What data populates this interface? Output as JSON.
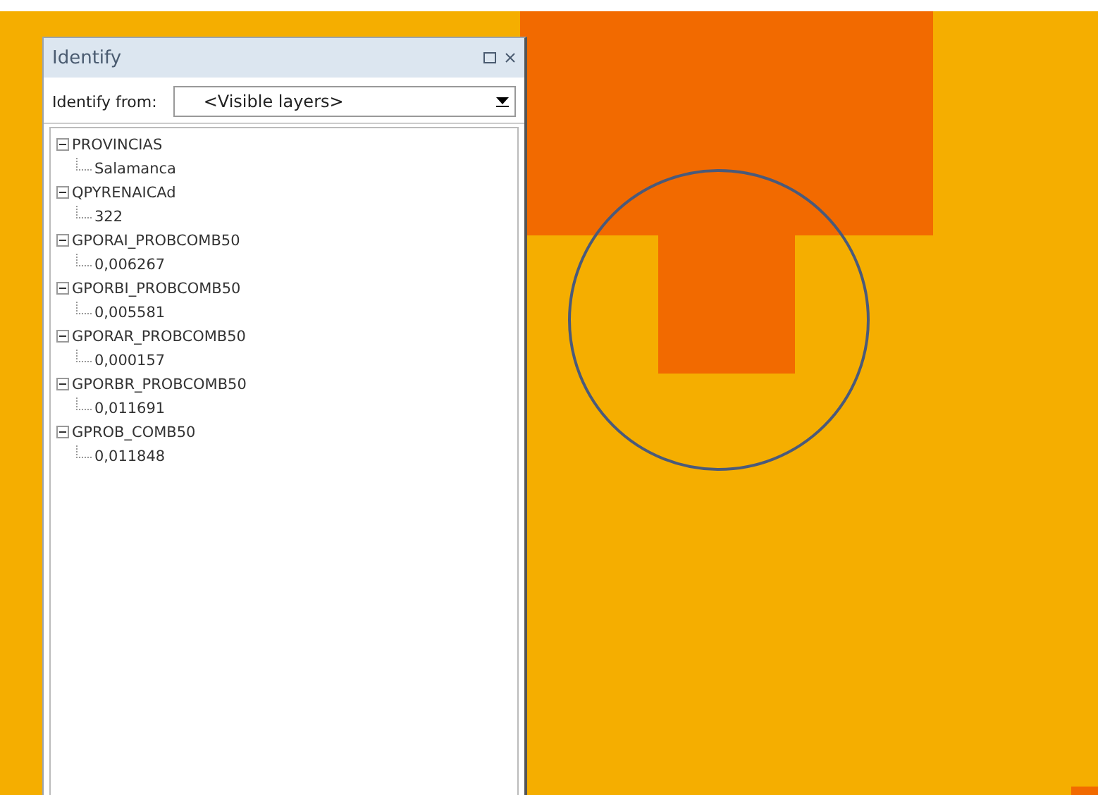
{
  "panel": {
    "title": "Identify",
    "identify_from": {
      "label": "Identify from:",
      "value": "<Visible layers>"
    }
  },
  "layers": [
    {
      "name": "PROVINCIAS",
      "expanded": true,
      "children": [
        "Salamanca"
      ]
    },
    {
      "name": "QPYRENAICAd",
      "expanded": true,
      "children": [
        "322"
      ]
    },
    {
      "name": "GPORAI_PROBCOMB50",
      "expanded": true,
      "children": [
        "0,006267"
      ]
    },
    {
      "name": "GPORBI_PROBCOMB50",
      "expanded": true,
      "children": [
        "0,005581"
      ]
    },
    {
      "name": "GPORAR_PROBCOMB50",
      "expanded": true,
      "children": [
        "0,000157"
      ]
    },
    {
      "name": "GPORBR_PROBCOMB50",
      "expanded": true,
      "children": [
        "0,011691"
      ]
    },
    {
      "name": "GPROB_COMB50",
      "expanded": true,
      "children": [
        "0,011848"
      ]
    }
  ]
}
